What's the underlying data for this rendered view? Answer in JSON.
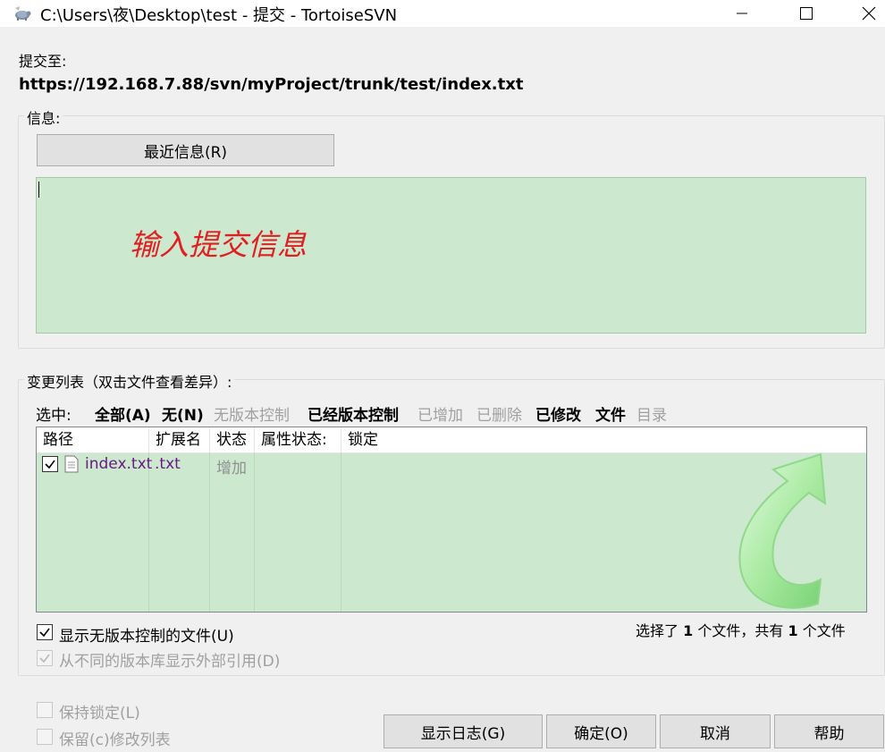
{
  "window": {
    "title": "C:\\Users\\夜\\Desktop\\test - 提交 - TortoiseSVN"
  },
  "commit_to": {
    "label": "提交至:",
    "url": "https://192.168.7.88/svn/myProject/trunk/test/index.txt"
  },
  "message": {
    "group_label": "信息:",
    "recent_button": "最近信息(R)",
    "hint": "输入提交信息"
  },
  "changes": {
    "group_label": "变更列表（双击文件查看差异）:",
    "select_label": "选中:",
    "filters": [
      {
        "label": "全部(A)",
        "enabled": true
      },
      {
        "label": "无(N)",
        "enabled": true
      },
      {
        "label": "无版本控制",
        "enabled": false
      },
      {
        "label": "已经版本控制",
        "enabled": true
      },
      {
        "label": "已增加",
        "enabled": false
      },
      {
        "label": "已删除",
        "enabled": false
      },
      {
        "label": "已修改",
        "enabled": true
      },
      {
        "label": "文件",
        "enabled": true
      },
      {
        "label": "目录",
        "enabled": false
      }
    ],
    "columns": [
      "路径",
      "扩展名",
      "状态",
      "属性状态:",
      "锁定"
    ],
    "rows": [
      {
        "checked": true,
        "path": "index.txt",
        "ext": ".txt",
        "status": "增加",
        "prop_status": "",
        "lock": ""
      }
    ],
    "show_unversioned": "显示无版本控制的文件(U)",
    "show_externals": "从不同的版本库显示外部引用(D)",
    "count_prefix": "选择了",
    "selected": "1",
    "count_middle": "个文件，共有",
    "total": "1",
    "count_suffix": "个文件"
  },
  "options": {
    "keep_locks": "保持锁定(L)",
    "keep_changelists": "保留(c)修改列表"
  },
  "buttons": {
    "show_log": "显示日志(G)",
    "ok": "确定(O)",
    "cancel": "取消",
    "help": "帮助"
  },
  "colors": {
    "list_background": "#cce8cf",
    "hint_text": "#e02020",
    "filename": "#6a1b82"
  }
}
